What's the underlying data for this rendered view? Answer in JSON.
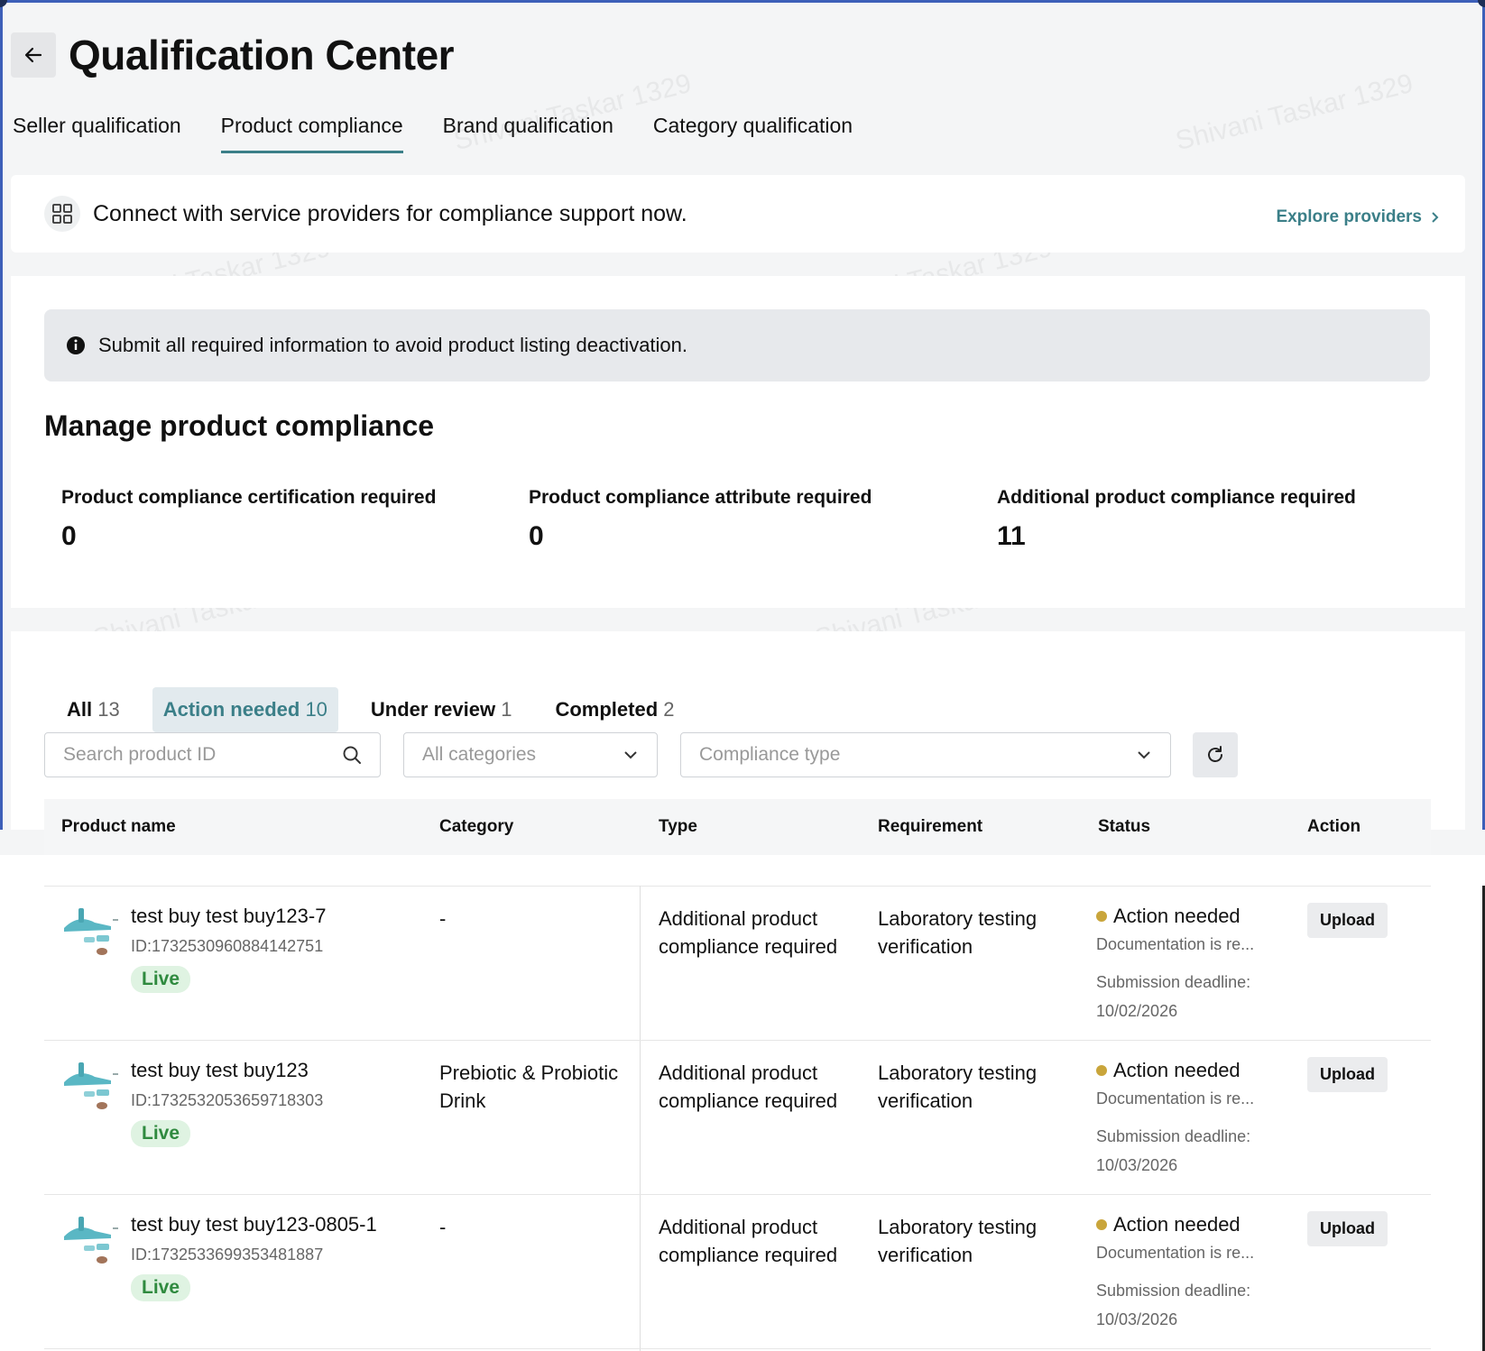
{
  "header": {
    "title": "Qualification Center"
  },
  "tabs": [
    {
      "label": "Seller qualification"
    },
    {
      "label": "Product compliance"
    },
    {
      "label": "Brand qualification"
    },
    {
      "label": "Category qualification"
    }
  ],
  "banner": {
    "text": "Connect with service providers for compliance support now.",
    "link": "Explore providers"
  },
  "notice": {
    "text": "Submit all required information to avoid product listing deactivation."
  },
  "manage": {
    "title": "Manage product compliance",
    "stats": [
      {
        "label": "Product compliance certification required",
        "value": "0"
      },
      {
        "label": "Product compliance attribute required",
        "value": "0"
      },
      {
        "label": "Additional product compliance required",
        "value": "11"
      }
    ]
  },
  "filters": {
    "tabs": [
      {
        "label": "All",
        "count": "13"
      },
      {
        "label": "Action needed",
        "count": "10"
      },
      {
        "label": "Under review",
        "count": "1"
      },
      {
        "label": "Completed",
        "count": "2"
      }
    ],
    "search_placeholder": "Search product ID",
    "category_placeholder": "All categories",
    "compliance_placeholder": "Compliance type"
  },
  "table": {
    "columns": [
      "Product name",
      "Category",
      "Type",
      "Requirement",
      "Status",
      "Action"
    ],
    "rows": [
      {
        "name": "test buy test buy123-7",
        "id": "ID:1732530960884142751",
        "badge": "Live",
        "category": "-",
        "type": "Additional product compliance required",
        "requirement": "Laboratory testing verification",
        "status": "Action needed",
        "note": "Documentation is re...",
        "deadline_label": "Submission deadline:",
        "deadline": "10/02/2026",
        "action": "Upload"
      },
      {
        "name": "test buy test buy123",
        "id": "ID:1732532053659718303",
        "badge": "Live",
        "category": "Prebiotic & Probiotic Drink",
        "type": "Additional product compliance required",
        "requirement": "Laboratory testing verification",
        "status": "Action needed",
        "note": "Documentation is re...",
        "deadline_label": "Submission deadline:",
        "deadline": "10/03/2026",
        "action": "Upload"
      },
      {
        "name": "test buy test buy123-0805-1",
        "id": "ID:1732533699353481887",
        "badge": "Live",
        "category": "-",
        "type": "Additional product compliance required",
        "requirement": "Laboratory testing verification",
        "status": "Action needed",
        "note": "Documentation is re...",
        "deadline_label": "Submission deadline:",
        "deadline": "10/03/2026",
        "action": "Upload"
      }
    ]
  },
  "watermark": "Shivani Taskar 1329",
  "colors": {
    "accent": "#3b7f88",
    "status_dot": "#c9a53b",
    "live_bg": "#dff3e2",
    "live_text": "#2f8a3f"
  }
}
